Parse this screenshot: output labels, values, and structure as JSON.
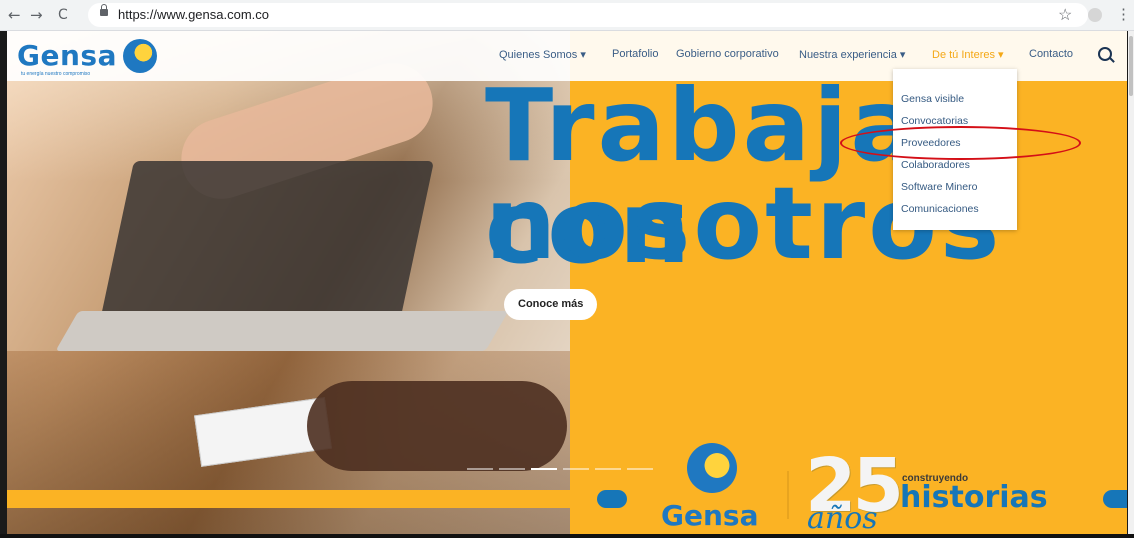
{
  "browser": {
    "url": "https://www.gensa.com.co",
    "back_icon": "←",
    "forward_icon": "→",
    "reload_icon": "C",
    "star_icon": "☆",
    "menu_icon": "⋮"
  },
  "site": {
    "logo_text": "Gensa",
    "logo_tagline": "tu energía nuestro compromiso",
    "nav": {
      "quienes_somos": "Quienes Somos ▾",
      "portafolio": "Portafolio",
      "gobierno": "Gobierno corporativo",
      "experiencia": "Nuestra experiencia ▾",
      "interes": "De tú Interes ▾",
      "contacto": "Contacto"
    },
    "dropdown": [
      "Gensa visible",
      "Convocatorias",
      "Proveedores",
      "Colaboradores",
      "Software Minero",
      "Comunicaciones"
    ],
    "headline_line1": "Trabaja con",
    "headline_line2": "nosotros",
    "cta": "Conoce más",
    "footer_logo": "Gensa",
    "anniversary_number": "25",
    "anniversary_word": "años",
    "construyendo": "construyendo",
    "historias": "historias"
  },
  "colors": {
    "brand_blue": "#1676b8",
    "brand_yellow": "#fbb324",
    "highlight_red": "#d40f17",
    "menu_active": "#f4a816"
  }
}
